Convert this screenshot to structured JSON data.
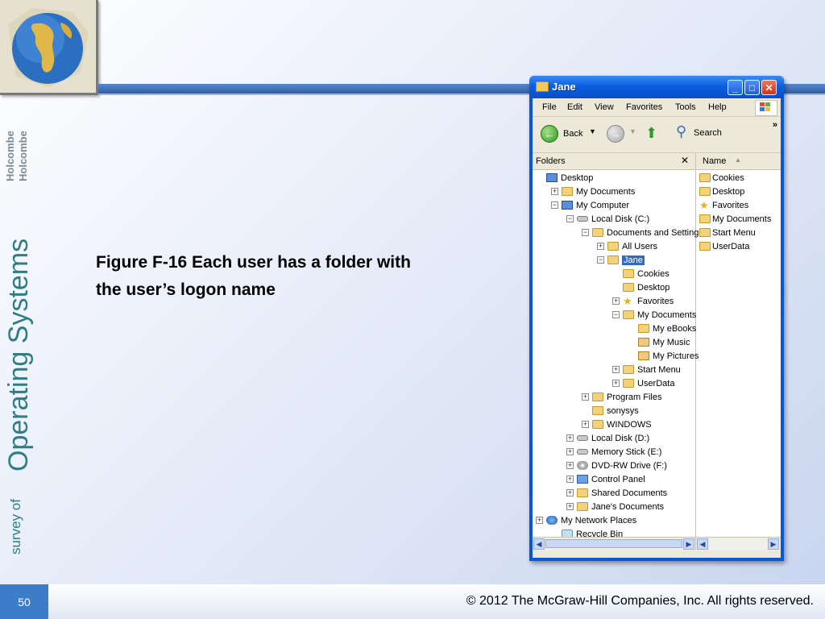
{
  "slide": {
    "branding": {
      "series_prefix": "survey of",
      "series_title": "Operating Systems",
      "authors": [
        "Holcombe",
        "Holcombe"
      ]
    },
    "caption_line1": "Figure F-16  Each user has a folder with",
    "caption_line2": "the user’s logon name",
    "page_number": "50",
    "copyright": "© 2012 The McGraw-Hill Companies, Inc. All rights reserved.",
    "colors": {
      "accent_blue": "#2f5ea6",
      "brand_teal": "#2f7e86",
      "footer_badge": "#3d7cc9"
    }
  },
  "explorer": {
    "title": "Jane",
    "controls": {
      "minimize": "_",
      "maximize": "□",
      "close": "✕"
    },
    "menu": [
      "File",
      "Edit",
      "View",
      "Favorites",
      "Tools",
      "Help"
    ],
    "toolbar": {
      "back": "Back",
      "search": "Search",
      "more": "»"
    },
    "folders_header": "Folders",
    "folders_close": "✕",
    "list_header": "Name",
    "tree": [
      {
        "label": "Desktop",
        "indent": 0,
        "icon": "blue",
        "exp": ""
      },
      {
        "label": "My Documents",
        "indent": 1,
        "icon": "folder",
        "exp": "+"
      },
      {
        "label": "My Computer",
        "indent": 1,
        "icon": "blue",
        "exp": "−"
      },
      {
        "label": "Local Disk (C:)",
        "indent": 2,
        "icon": "drive",
        "exp": "−"
      },
      {
        "label": "Documents and Settings",
        "indent": 3,
        "icon": "folder",
        "exp": "−"
      },
      {
        "label": "All Users",
        "indent": 4,
        "icon": "folder",
        "exp": "+"
      },
      {
        "label": "Jane",
        "indent": 4,
        "icon": "folder",
        "exp": "−",
        "selected": true
      },
      {
        "label": "Cookies",
        "indent": 5,
        "icon": "folder",
        "exp": ""
      },
      {
        "label": "Desktop",
        "indent": 5,
        "icon": "folder",
        "exp": ""
      },
      {
        "label": "Favorites",
        "indent": 5,
        "icon": "star",
        "exp": "+"
      },
      {
        "label": "My Documents",
        "indent": 5,
        "icon": "folder",
        "exp": "−"
      },
      {
        "label": "My eBooks",
        "indent": 6,
        "icon": "folder",
        "exp": ""
      },
      {
        "label": "My Music",
        "indent": 6,
        "icon": "media",
        "exp": ""
      },
      {
        "label": "My Pictures",
        "indent": 6,
        "icon": "media",
        "exp": ""
      },
      {
        "label": "Start Menu",
        "indent": 5,
        "icon": "folder",
        "exp": "+"
      },
      {
        "label": "UserData",
        "indent": 5,
        "icon": "folder",
        "exp": "+"
      },
      {
        "label": "Program Files",
        "indent": 3,
        "icon": "folder",
        "exp": "+"
      },
      {
        "label": "sonysys",
        "indent": 3,
        "icon": "folder",
        "exp": ""
      },
      {
        "label": "WINDOWS",
        "indent": 3,
        "icon": "folder",
        "exp": "+"
      },
      {
        "label": "Local Disk (D:)",
        "indent": 2,
        "icon": "drive",
        "exp": "+"
      },
      {
        "label": "Memory Stick (E:)",
        "indent": 2,
        "icon": "drive",
        "exp": "+"
      },
      {
        "label": "DVD-RW Drive (F:)",
        "indent": 2,
        "icon": "disc",
        "exp": "+"
      },
      {
        "label": "Control Panel",
        "indent": 2,
        "icon": "cp",
        "exp": "+"
      },
      {
        "label": "Shared Documents",
        "indent": 2,
        "icon": "folder",
        "exp": "+"
      },
      {
        "label": "Jane's Documents",
        "indent": 2,
        "icon": "folder",
        "exp": "+"
      },
      {
        "label": "My Network Places",
        "indent": 0,
        "icon": "net",
        "exp": "+"
      },
      {
        "label": "Recycle Bin",
        "indent": 1,
        "icon": "bin",
        "exp": ""
      }
    ],
    "list_items": [
      {
        "label": "Cookies",
        "icon": "folder"
      },
      {
        "label": "Desktop",
        "icon": "folder"
      },
      {
        "label": "Favorites",
        "icon": "star"
      },
      {
        "label": "My Documents",
        "icon": "folder"
      },
      {
        "label": "Start Menu",
        "icon": "folder"
      },
      {
        "label": "UserData",
        "icon": "folder"
      }
    ]
  }
}
